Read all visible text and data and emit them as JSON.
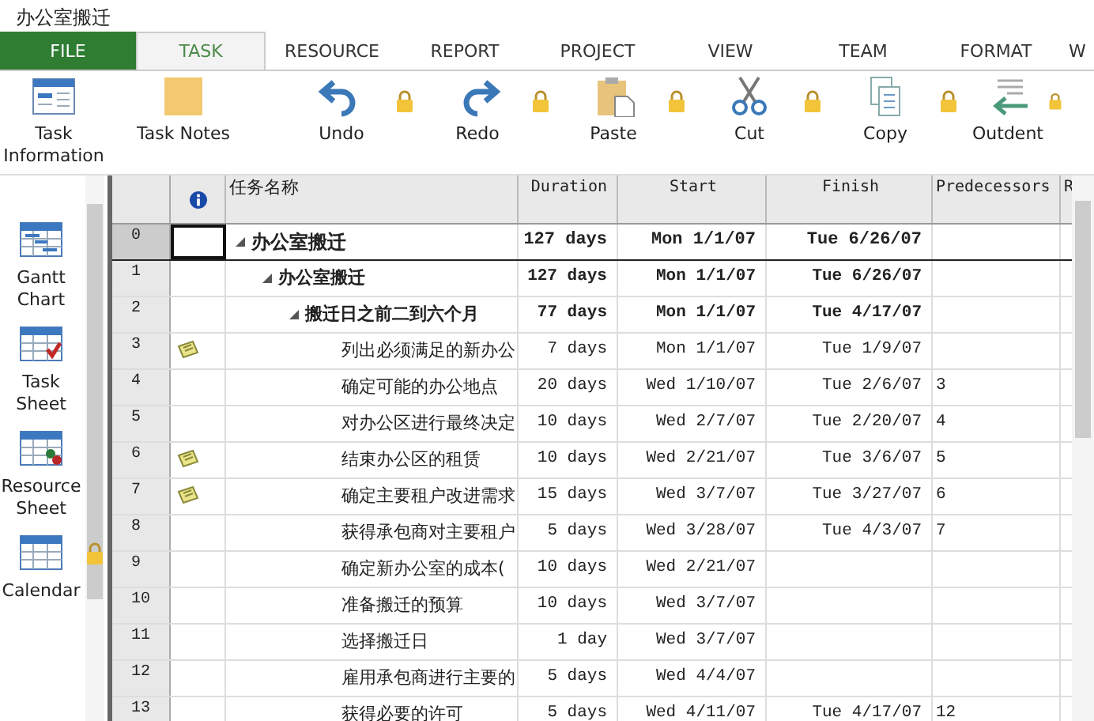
{
  "window": {
    "title": "办公室搬迁"
  },
  "tabs": [
    {
      "label": "FILE",
      "kind": "file",
      "selected": false
    },
    {
      "label": "TASK",
      "kind": "tab",
      "selected": true
    },
    {
      "label": "RESOURCE",
      "kind": "tab",
      "selected": false
    },
    {
      "label": "REPORT",
      "kind": "tab",
      "selected": false
    },
    {
      "label": "PROJECT",
      "kind": "tab",
      "selected": false
    },
    {
      "label": "VIEW",
      "kind": "tab",
      "selected": false
    },
    {
      "label": "TEAM",
      "kind": "tab",
      "selected": false
    },
    {
      "label": "FORMAT",
      "kind": "tab",
      "selected": false
    },
    {
      "label": "W",
      "kind": "tab",
      "selected": false
    }
  ],
  "ribbon": [
    {
      "label": "Task Information",
      "kind": "info",
      "locked": false
    },
    {
      "label": "Task Notes",
      "kind": "note",
      "locked": false
    },
    {
      "label": "Undo",
      "kind": "undo",
      "locked": true
    },
    {
      "label": "Redo",
      "kind": "redo",
      "locked": true
    },
    {
      "label": "Paste",
      "kind": "paste",
      "locked": true
    },
    {
      "label": "Cut",
      "kind": "cut",
      "locked": true
    },
    {
      "label": "Copy",
      "kind": "copy",
      "locked": true
    },
    {
      "label": "Outdent",
      "kind": "outdent",
      "locked": true
    }
  ],
  "sidebar": {
    "items": [
      {
        "label": "Gantt Chart",
        "kind": "gantt",
        "locked": false
      },
      {
        "label": "Task Sheet",
        "kind": "tasksheet",
        "locked": false
      },
      {
        "label": "Resource Sheet",
        "kind": "resource",
        "locked": false
      },
      {
        "label": "Calendar",
        "kind": "calendar",
        "locked": true
      }
    ]
  },
  "table": {
    "columns": [
      "任务名称",
      "Duration",
      "Start",
      "Finish",
      "Predecessors",
      "R"
    ],
    "tasks": [
      {
        "id": "0",
        "name": "办公室搬迁",
        "duration": "127 days",
        "start": "Mon 1/1/07",
        "finish": "Tue 6/26/07",
        "note": false,
        "selected": true,
        "expanded": true,
        "children": [
          {
            "id": "1",
            "name": "办公室搬迁",
            "duration": "127 days",
            "start": "Mon 1/1/07",
            "finish": "Tue 6/26/07",
            "note": false,
            "selected": false,
            "expanded": true,
            "children": [
              {
                "id": "2",
                "name": "搬迁日之前二到六个月",
                "duration": "77 days",
                "start": "Mon 1/1/07",
                "finish": "Tue 4/17/07",
                "note": false,
                "selected": false,
                "expanded": true,
                "children": [
                  {
                    "id": "3",
                    "name": "列出必须满足的新办公",
                    "duration": "7 days",
                    "start": "Mon 1/1/07",
                    "finish": "Tue 1/9/07",
                    "note": true,
                    "selected": false
                  },
                  {
                    "id": "4",
                    "name": "确定可能的办公地点",
                    "duration": "20 days",
                    "start": "Wed 1/10/07",
                    "finish": "Tue 2/6/07",
                    "predecessors": "3",
                    "note": false,
                    "selected": false
                  },
                  {
                    "id": "5",
                    "name": "对办公区进行最终决定",
                    "duration": "10 days",
                    "start": "Wed 2/7/07",
                    "finish": "Tue 2/20/07",
                    "predecessors": "4",
                    "note": false,
                    "selected": false
                  },
                  {
                    "id": "6",
                    "name": "结束办公区的租赁",
                    "duration": "10 days",
                    "start": "Wed 2/21/07",
                    "finish": "Tue 3/6/07",
                    "predecessors": "5",
                    "note": true,
                    "selected": false
                  },
                  {
                    "id": "7",
                    "name": "确定主要租户改进需求",
                    "duration": "15 days",
                    "start": "Wed 3/7/07",
                    "finish": "Tue 3/27/07",
                    "predecessors": "6",
                    "note": true,
                    "selected": false
                  },
                  {
                    "id": "8",
                    "name": "获得承包商对主要租户",
                    "duration": "5 days",
                    "start": "Wed 3/28/07",
                    "finish": "Tue 4/3/07",
                    "predecessors": "7",
                    "note": false,
                    "selected": false
                  },
                  {
                    "id": "9",
                    "name": "确定新办公室的成本(",
                    "duration": "10 days",
                    "start": "Wed 2/21/07",
                    "note": false,
                    "selected": false
                  },
                  {
                    "id": "10",
                    "name": "准备搬迁的预算",
                    "duration": "10 days",
                    "start": "Wed 3/7/07",
                    "note": false,
                    "selected": false
                  },
                  {
                    "id": "11",
                    "name": "选择搬迁日",
                    "duration": "1 day",
                    "start": "Wed 3/7/07",
                    "note": false,
                    "selected": false
                  },
                  {
                    "id": "12",
                    "name": "雇用承包商进行主要的",
                    "duration": "5 days",
                    "start": "Wed 4/4/07",
                    "note": false,
                    "selected": false
                  },
                  {
                    "id": "13",
                    "name": "获得必要的许可",
                    "duration": "5 days",
                    "start": "Wed 4/11/07",
                    "finish": "Tue 4/17/07",
                    "predecessors": "12",
                    "note": false,
                    "selected": false
                  }
                ]
              }
            ]
          }
        ]
      }
    ]
  }
}
